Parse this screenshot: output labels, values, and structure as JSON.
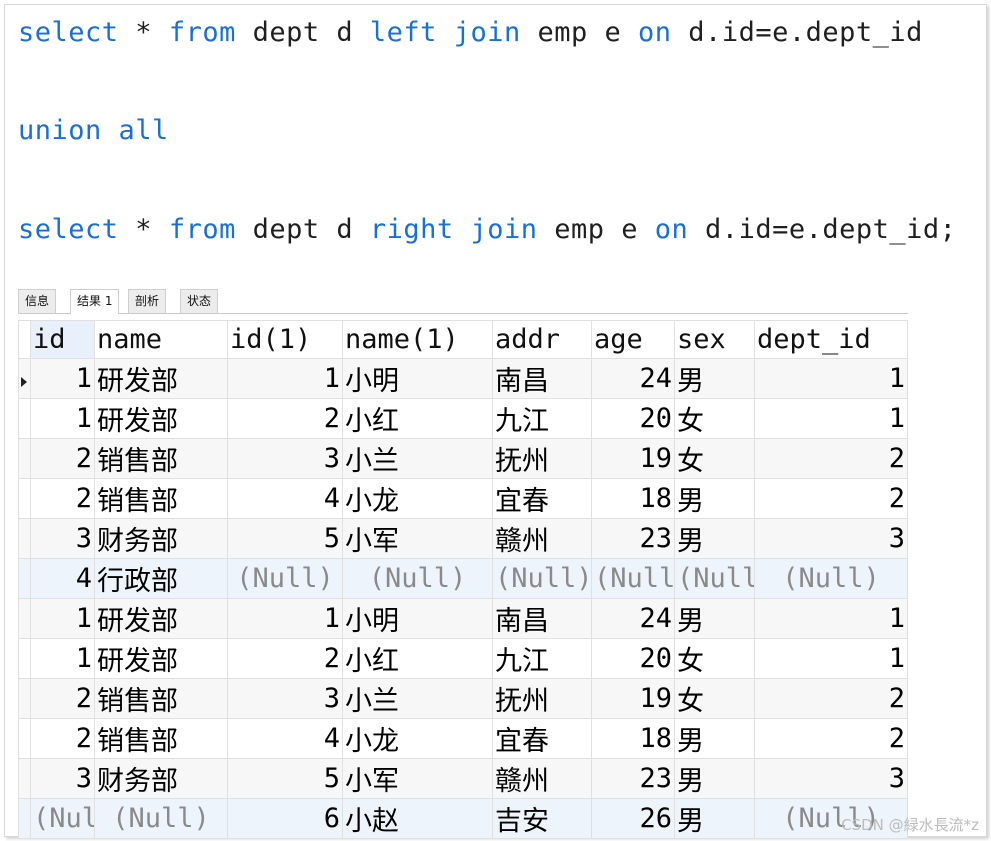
{
  "sql": {
    "line1": [
      {
        "t": "select",
        "k": true
      },
      {
        "t": " * ",
        "k": false
      },
      {
        "t": "from",
        "k": true
      },
      {
        "t": " dept d ",
        "k": false
      },
      {
        "t": "left",
        "k": true
      },
      {
        "t": " ",
        "k": false
      },
      {
        "t": "join",
        "k": true
      },
      {
        "t": " emp e ",
        "k": false
      },
      {
        "t": "on",
        "k": true
      },
      {
        "t": " d.id=e.dept_id",
        "k": false
      }
    ],
    "line2": [
      {
        "t": "union all",
        "k": true
      }
    ],
    "line3": [
      {
        "t": "select",
        "k": true
      },
      {
        "t": " * ",
        "k": false
      },
      {
        "t": "from",
        "k": true
      },
      {
        "t": " dept d ",
        "k": false
      },
      {
        "t": "right",
        "k": true
      },
      {
        "t": " ",
        "k": false
      },
      {
        "t": "join",
        "k": true
      },
      {
        "t": " emp e ",
        "k": false
      },
      {
        "t": "on",
        "k": true
      },
      {
        "t": " d.id=e.dept_id;",
        "k": false
      }
    ]
  },
  "tabs": [
    "信息",
    "结果 1",
    "剖析",
    "状态"
  ],
  "active_tab": 1,
  "columns": [
    "id",
    "name",
    "id(1)",
    "name(1)",
    "addr",
    "age",
    "sex",
    "dept_id"
  ],
  "rows": [
    [
      "1",
      "研发部",
      "1",
      "小明",
      "南昌",
      "24",
      "男",
      "1"
    ],
    [
      "1",
      "研发部",
      "2",
      "小红",
      "九江",
      "20",
      "女",
      "1"
    ],
    [
      "2",
      "销售部",
      "3",
      "小兰",
      "抚州",
      "19",
      "女",
      "2"
    ],
    [
      "2",
      "销售部",
      "4",
      "小龙",
      "宜春",
      "18",
      "男",
      "2"
    ],
    [
      "3",
      "财务部",
      "5",
      "小军",
      "赣州",
      "23",
      "男",
      "3"
    ],
    [
      "4",
      "行政部",
      "(Null)",
      "(Null)",
      "(Null)",
      "(Null)",
      "(Null)",
      "(Null)"
    ],
    [
      "1",
      "研发部",
      "1",
      "小明",
      "南昌",
      "24",
      "男",
      "1"
    ],
    [
      "1",
      "研发部",
      "2",
      "小红",
      "九江",
      "20",
      "女",
      "1"
    ],
    [
      "2",
      "销售部",
      "3",
      "小兰",
      "抚州",
      "19",
      "女",
      "2"
    ],
    [
      "2",
      "销售部",
      "4",
      "小龙",
      "宜春",
      "18",
      "男",
      "2"
    ],
    [
      "3",
      "财务部",
      "5",
      "小军",
      "赣州",
      "23",
      "男",
      "3"
    ],
    [
      "(Null)",
      "(Null)",
      "6",
      "小赵",
      "吉安",
      "26",
      "男",
      "(Null)"
    ]
  ],
  "null_text": "(Null)",
  "watermark": "CSDN @緑水長流*z"
}
